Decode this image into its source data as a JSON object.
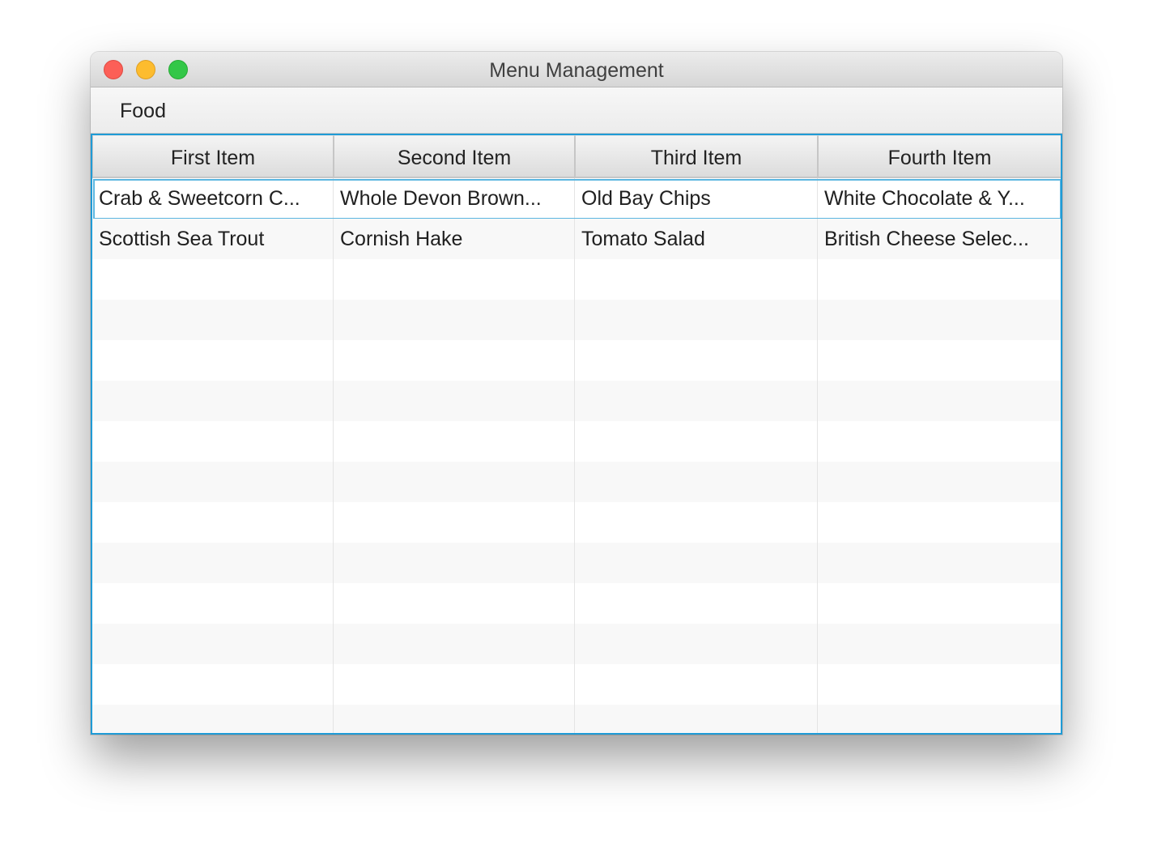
{
  "window": {
    "title": "Menu Management"
  },
  "menubar": {
    "items": [
      {
        "label": "Food"
      }
    ]
  },
  "table": {
    "columns": [
      "First Item",
      "Second Item",
      "Third Item",
      "Fourth Item"
    ],
    "rows": [
      [
        "Crab & Sweetcorn C...",
        "Whole Devon Brown...",
        "Old Bay Chips",
        "White Chocolate & Y..."
      ],
      [
        "Scottish Sea Trout",
        "Cornish Hake",
        "Tomato Salad",
        "British Cheese Selec..."
      ]
    ],
    "selected_row": 0
  },
  "colors": {
    "accent": "#1f9bd6",
    "close": "#fc5f57",
    "minimize": "#fdbc2e",
    "zoom": "#33c748"
  }
}
